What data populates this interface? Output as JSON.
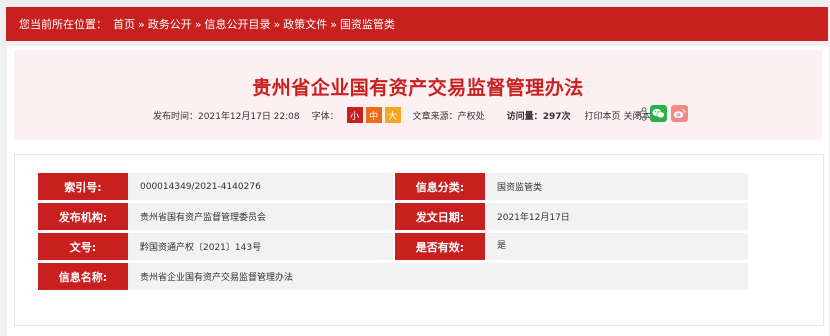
{
  "breadcrumb": {
    "prefix": "您当前所在位置：",
    "items": [
      "首页",
      "政务公开",
      "信息公开目录",
      "政策文件",
      "国资监管类"
    ],
    "separator": "»"
  },
  "article": {
    "title": "贵州省企业国有资产交易监督管理办法",
    "publish_label": "发布时间：",
    "publish_time": "2021年12月17日 22:08",
    "font_label": "字体：",
    "font_sizes": [
      "小",
      "中",
      "大"
    ],
    "source_label": "文章来源：",
    "source": "产权处",
    "views_label": "访问量：",
    "views": "297次",
    "print_label": "打印本页",
    "close_label": "关闭本页"
  },
  "info": {
    "index_label": "索引号:",
    "index_value": "000014349/2021-4140276",
    "category_label": "信息分类:",
    "category_value": "国资监管类",
    "publisher_label": "发布机构:",
    "publisher_value": "贵州省国有资产监督管理委员会",
    "date_label": "发文日期:",
    "date_value": "2021年12月17日",
    "doc_no_label": "文号:",
    "doc_no_value": "黔国资通产权〔2021〕143号",
    "valid_label": "是否有效:",
    "valid_value": "是",
    "name_label": "信息名称:",
    "name_value": "贵州省企业国有资产交易监督管理办法"
  },
  "colors": {
    "accent": "#c8201f",
    "wechat": "#2bb14c",
    "weibo": "#f08a86"
  },
  "icons": [
    "share-icon",
    "wechat-icon",
    "weibo-icon"
  ]
}
